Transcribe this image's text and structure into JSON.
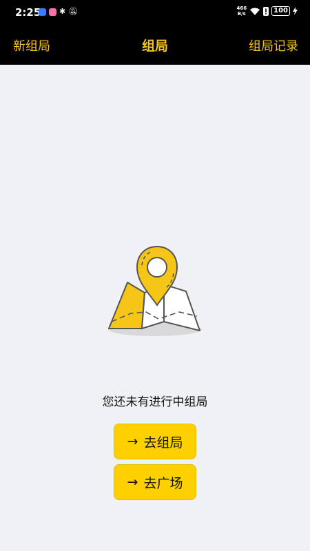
{
  "status_bar": {
    "time": "2:25",
    "net_speed_value": "466",
    "net_speed_unit": "B/s",
    "battery": "100"
  },
  "nav": {
    "left_label": "新组局",
    "title": "组局",
    "right_label": "组局记录"
  },
  "empty_state": {
    "message": "您还未有进行中组局",
    "illustration": "map-pin-icon"
  },
  "buttons": {
    "arrow": "→",
    "go_group_label": "去组局",
    "go_square_label": "去广场"
  },
  "colors": {
    "accent": "#f5c518",
    "button_bg": "#ffd000",
    "header_bg": "#000000",
    "page_bg": "#f0f1f5"
  }
}
